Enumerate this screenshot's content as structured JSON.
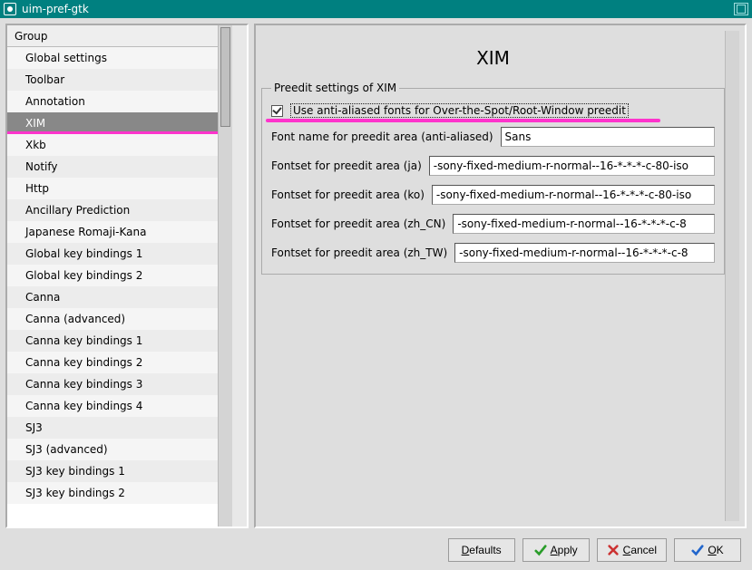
{
  "window": {
    "title": "uim-pref-gtk"
  },
  "sidebar": {
    "header": "Group",
    "items": [
      {
        "label": "Global settings"
      },
      {
        "label": "Toolbar"
      },
      {
        "label": "Annotation"
      },
      {
        "label": "XIM",
        "selected": true
      },
      {
        "label": "Xkb"
      },
      {
        "label": "Notify"
      },
      {
        "label": "Http"
      },
      {
        "label": "Ancillary Prediction"
      },
      {
        "label": "Japanese Romaji-Kana"
      },
      {
        "label": "Global key bindings 1"
      },
      {
        "label": "Global key bindings 2"
      },
      {
        "label": "Canna"
      },
      {
        "label": "Canna (advanced)"
      },
      {
        "label": "Canna key bindings 1"
      },
      {
        "label": "Canna key bindings 2"
      },
      {
        "label": "Canna key bindings 3"
      },
      {
        "label": "Canna key bindings 4"
      },
      {
        "label": "SJ3"
      },
      {
        "label": "SJ3 (advanced)"
      },
      {
        "label": "SJ3 key bindings 1"
      },
      {
        "label": "SJ3 key bindings 2"
      }
    ]
  },
  "page": {
    "title": "XIM",
    "fieldset_legend": "Preedit settings of XIM",
    "checkbox": {
      "checked": true,
      "label": "Use anti-aliased fonts for Over-the-Spot/Root-Window preedit"
    },
    "rows": [
      {
        "label": "Font name for preedit area (anti-aliased)",
        "value": "Sans"
      },
      {
        "label": "Fontset for preedit area (ja)",
        "value": "-sony-fixed-medium-r-normal--16-*-*-*-c-80-iso"
      },
      {
        "label": "Fontset for preedit area (ko)",
        "value": "-sony-fixed-medium-r-normal--16-*-*-*-c-80-iso"
      },
      {
        "label": "Fontset for preedit area (zh_CN)",
        "value": "-sony-fixed-medium-r-normal--16-*-*-*-c-8"
      },
      {
        "label": "Fontset for preedit area (zh_TW)",
        "value": "-sony-fixed-medium-r-normal--16-*-*-*-c-8"
      }
    ]
  },
  "buttons": {
    "defaults": "Defaults",
    "apply": "Apply",
    "cancel": "Cancel",
    "ok": "OK"
  }
}
